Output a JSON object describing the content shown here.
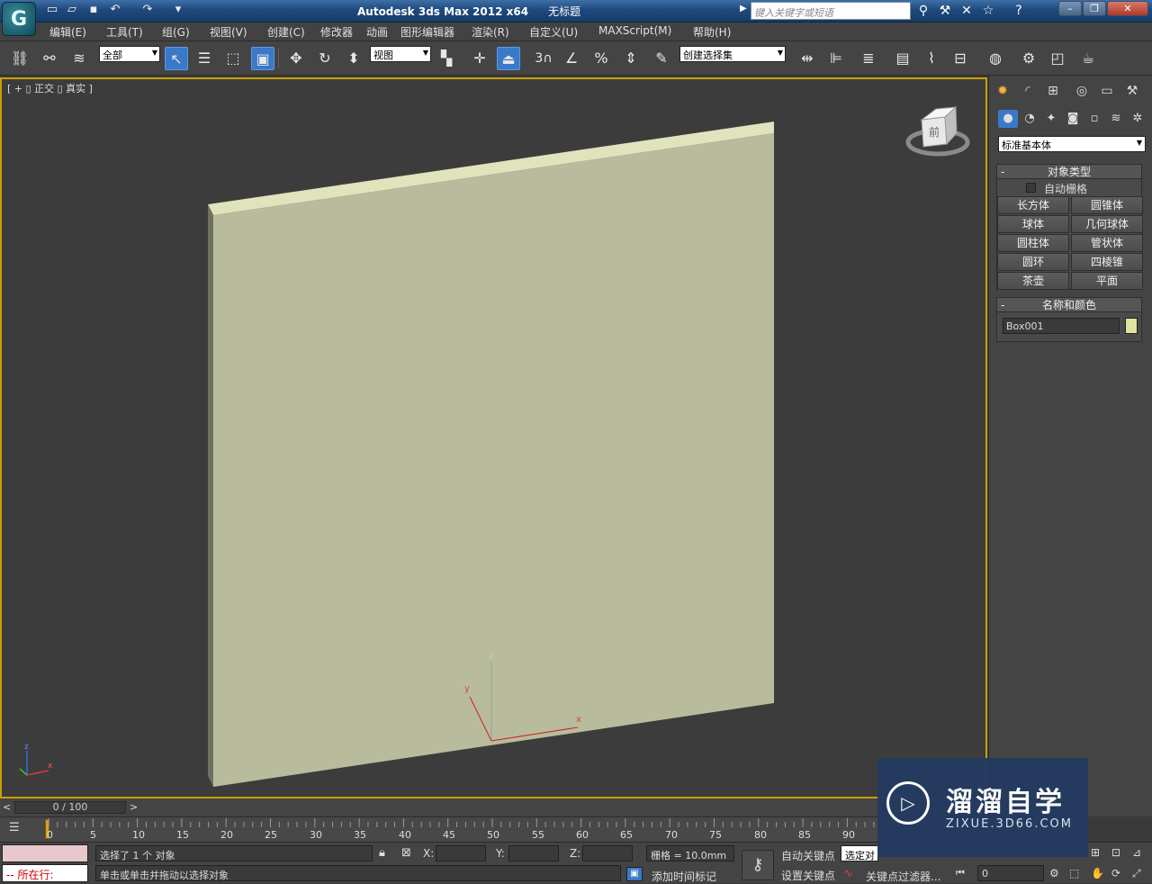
{
  "app": {
    "title": "Autodesk 3ds Max  2012 x64",
    "doc_title": "无标题",
    "logo_letter": "G"
  },
  "search": {
    "placeholder": "键入关键字或短语"
  },
  "menus": [
    "编辑(E)",
    "工具(T)",
    "组(G)",
    "视图(V)",
    "创建(C)",
    "修改器",
    "动画",
    "图形编辑器",
    "渲染(R)",
    "自定义(U)",
    "MAXScript(M)",
    "帮助(H)"
  ],
  "toolbar": {
    "filter_select": "全部",
    "ref_coord": "视图",
    "named_selection": "创建选择集",
    "snap_label": "3"
  },
  "viewport": {
    "label": "[ + ▯ 正交 ▯ 真实 ]",
    "viewcube_face": "前",
    "axis_x": "x",
    "axis_y": "y",
    "axis_z": "z",
    "object_color": "#b8bc9c"
  },
  "panel": {
    "std_primitive": "标准基本体",
    "object_type_title": "对象类型",
    "autogrid_label": "自动栅格",
    "buttons": [
      "长方体",
      "圆锥体",
      "球体",
      "几何球体",
      "圆柱体",
      "管状体",
      "圆环",
      "四棱锥",
      "茶壶",
      "平面"
    ],
    "name_color_title": "名称和颜色",
    "object_name": "Box001",
    "object_swatch": "#e0e4a0"
  },
  "timeline": {
    "frame_display": "0 / 100",
    "ticks": [
      "0",
      "5",
      "10",
      "15",
      "20",
      "25",
      "30",
      "35",
      "40",
      "45",
      "50",
      "55",
      "60",
      "65",
      "70",
      "75",
      "80",
      "85",
      "90"
    ]
  },
  "status": {
    "selected_text": "选择了 1 个 对象",
    "prompt_text": "单击或单击并拖动以选择对象",
    "listener_label": "所在行:",
    "x_label": "X:",
    "y_label": "Y:",
    "z_label": "Z:",
    "grid_text": "栅格 = 10.0mm",
    "auto_key": "自动关键点",
    "set_key": "设置关键点",
    "selected_dropdown": "选定对",
    "add_time_tag": "添加时间标记",
    "key_filters": "关键点过滤器...",
    "frame_value": "0"
  },
  "watermark": {
    "title": "溜溜自学",
    "url": "ZIXUE.3D66.COM"
  }
}
